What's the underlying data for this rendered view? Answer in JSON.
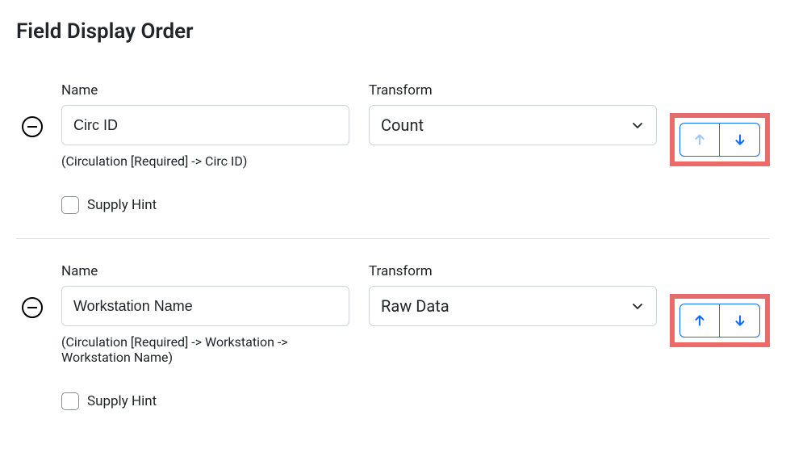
{
  "title": "Field Display Order",
  "labels": {
    "name": "Name",
    "transform": "Transform",
    "supply_hint": "Supply Hint"
  },
  "fields": [
    {
      "name": "Circ ID",
      "transform": "Count",
      "path": "(Circulation [Required] -> Circ ID)",
      "supply_hint_checked": false,
      "up_enabled": false,
      "down_enabled": true
    },
    {
      "name": "Workstation Name",
      "transform": "Raw Data",
      "path": "(Circulation [Required] -> Workstation -> Workstation Name)",
      "supply_hint_checked": false,
      "up_enabled": true,
      "down_enabled": true
    }
  ]
}
